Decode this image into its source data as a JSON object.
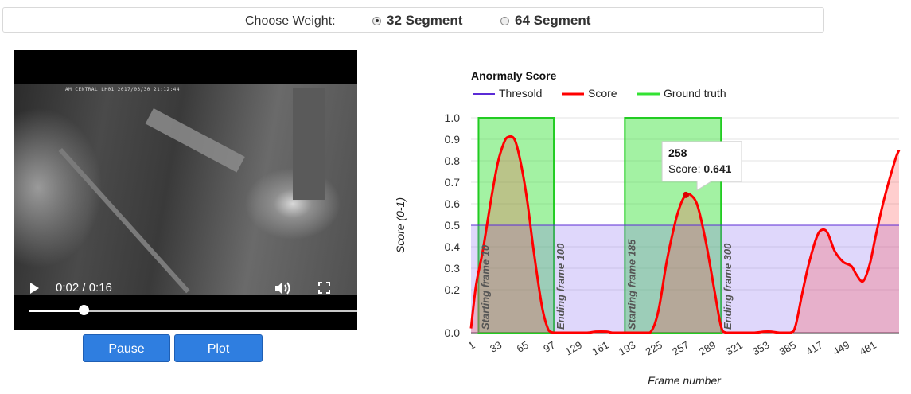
{
  "weight_bar": {
    "label": "Choose Weight:",
    "options": [
      {
        "label": "32 Segment",
        "selected": true
      },
      {
        "label": "64 Segment",
        "selected": false
      }
    ]
  },
  "video": {
    "overlay_text": "AM CENTRAL LH01 2017/03/30 21:12:44",
    "time": "0:02 / 0:16",
    "progress": 0.167
  },
  "buttons": {
    "pause": "Pause",
    "plot": "Plot"
  },
  "colors": {
    "threshold": "#5b2bd6",
    "score": "#ff0000",
    "ground_truth": "#33e233",
    "button": "#2f7ee0"
  },
  "chart_data": {
    "type": "line",
    "title": "Anormaly Score",
    "xlabel": "Frame number",
    "ylabel": "Score (0-1)",
    "xlim": [
      1,
      513
    ],
    "ylim": [
      0,
      1
    ],
    "x_ticks": [
      "1",
      "33",
      "65",
      "97",
      "129",
      "161",
      "193",
      "225",
      "257",
      "289",
      "321",
      "353",
      "385",
      "417",
      "449",
      "481"
    ],
    "y_ticks": [
      "0.0",
      "0.2",
      "0.3",
      "0.4",
      "0.5",
      "0.6",
      "0.7",
      "0.8",
      "0.9",
      "1.0"
    ],
    "legend": [
      {
        "name": "Thresold",
        "color": "#5b2bd6"
      },
      {
        "name": "Score",
        "color": "#ff0000"
      },
      {
        "name": "Ground truth",
        "color": "#33e233"
      }
    ],
    "threshold": 0.5,
    "ground_truth_ranges": [
      [
        10,
        100
      ],
      [
        185,
        300
      ]
    ],
    "annotations": [
      {
        "text": "Starting frame 10",
        "x": 10
      },
      {
        "text": "Ending frame 100",
        "x": 100
      },
      {
        "text": "Starting frame 185",
        "x": 185
      },
      {
        "text": "Ending frame 300",
        "x": 300
      }
    ],
    "tooltip": {
      "frame": "258",
      "label": "Score:",
      "value": "0.641"
    },
    "series": [
      {
        "name": "Score",
        "x": [
          1,
          7,
          15,
          25,
          33,
          40,
          45,
          53,
          60,
          68,
          76,
          86,
          94,
          100,
          106,
          120,
          140,
          150,
          163,
          170,
          180,
          200,
          215,
          225,
          235,
          245,
          252,
          258,
          264,
          272,
          282,
          292,
          300,
          306,
          320,
          340,
          352,
          360,
          370,
          383,
          389,
          397,
          405,
          415,
          422,
          428,
          436,
          446,
          456,
          462,
          470,
          478,
          485,
          495,
          508,
          513
        ],
        "y": [
          0.02,
          0.22,
          0.38,
          0.62,
          0.79,
          0.88,
          0.91,
          0.9,
          0.8,
          0.62,
          0.38,
          0.12,
          0.01,
          0.0,
          0.0,
          0.0,
          0.0,
          0.005,
          0.005,
          0.0,
          0.0,
          0.0,
          0.0,
          0.1,
          0.33,
          0.51,
          0.6,
          0.641,
          0.64,
          0.59,
          0.42,
          0.2,
          0.03,
          0.0,
          0.0,
          0.0,
          0.005,
          0.005,
          0.0,
          0.0,
          0.03,
          0.18,
          0.32,
          0.45,
          0.48,
          0.46,
          0.38,
          0.33,
          0.31,
          0.27,
          0.24,
          0.32,
          0.45,
          0.62,
          0.8,
          0.85
        ]
      }
    ]
  }
}
